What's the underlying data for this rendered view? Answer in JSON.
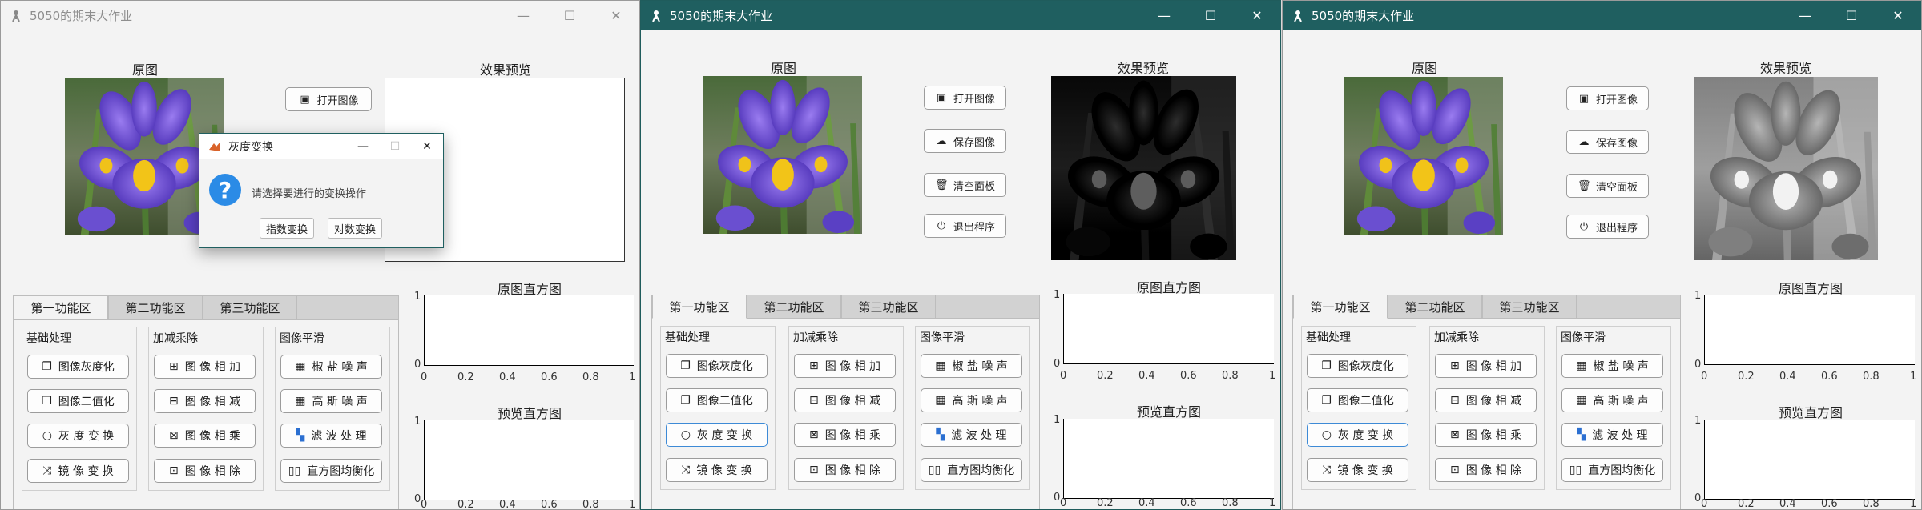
{
  "windows": [
    {
      "title": "5050的期末大作业",
      "min": "—",
      "max": "☐",
      "close": "✕"
    },
    {
      "title": "5050的期末大作业",
      "min": "—",
      "max": "☐",
      "close": "✕"
    },
    {
      "title": "5050的期末大作业",
      "min": "—",
      "max": "☐",
      "close": "✕"
    }
  ],
  "labels": {
    "original": "原图",
    "preview": "效果预览",
    "orig_hist": "原图直方图",
    "prev_hist": "预览直方图"
  },
  "side_buttons": [
    {
      "label": "打开图像",
      "icon": "image-icon"
    },
    {
      "label": "保存图像",
      "icon": "cloud-save-icon"
    },
    {
      "label": "清空面板",
      "icon": "trash-icon"
    },
    {
      "label": "退出程序",
      "icon": "power-icon"
    }
  ],
  "tabs": [
    "第一功能区",
    "第二功能区",
    "第三功能区"
  ],
  "groups": [
    {
      "title": "基础处理",
      "buttons": [
        "图像灰度化",
        "图像二值化",
        "灰 度 变 换",
        "镜 像 变 换"
      ]
    },
    {
      "title": "加减乘除",
      "buttons": [
        "图 像 相 加",
        "图 像 相 减",
        "图 像 相 乘",
        "图 像 相 除"
      ]
    },
    {
      "title": "图像平滑",
      "buttons": [
        "椒 盐 噪 声",
        "高 斯 噪 声",
        "滤 波 处 理",
        "直方图均衡化"
      ]
    }
  ],
  "axis_ticks": {
    "x": [
      "0",
      "0.2",
      "0.4",
      "0.6",
      "0.8",
      "1"
    ],
    "y": [
      "0",
      "1"
    ]
  },
  "dialog": {
    "title": "灰度变换",
    "min": "—",
    "max": "☐",
    "close": "✕",
    "icon_text": "?",
    "message": "请选择要进行的变换操作",
    "button1": "指数变换",
    "button2": "对数变换"
  },
  "colors": {
    "title_bar_active": "#1f5f60",
    "accent": "#3d8ad6"
  }
}
